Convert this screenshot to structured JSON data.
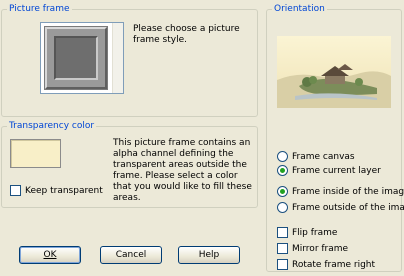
{
  "picture_frame": {
    "title": "Picture frame",
    "hint": "Please choose a picture frame style."
  },
  "transparency": {
    "title": "Transparency color",
    "swatch_color": "#f8efc8",
    "description": "This picture frame contains an alpha channel defining the transparent areas outside the frame.  Please select a color that you would like to fill these areas.",
    "keep_label": "Keep transparent",
    "keep_checked": false
  },
  "orientation": {
    "title": "Orientation",
    "frame_canvas": "Frame canvas",
    "frame_current_layer": "Frame current layer",
    "frame_target_selected": "Frame current layer",
    "frame_inside": "Frame inside of the image",
    "frame_outside": "Frame outside of the image",
    "frame_position_selected": "Frame inside of the image",
    "flip_label": "Flip frame",
    "mirror_label": "Mirror frame",
    "rotate_label": "Rotate frame right"
  },
  "buttons": {
    "ok": "OK",
    "cancel": "Cancel",
    "help": "Help"
  }
}
